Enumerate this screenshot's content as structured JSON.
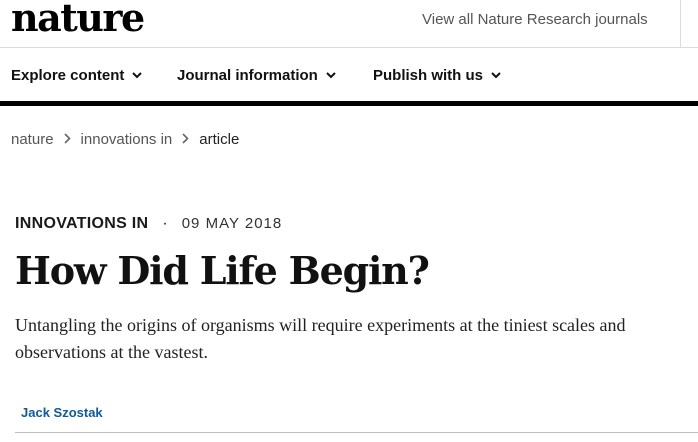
{
  "header": {
    "logo": "nature",
    "journals_link": "View all Nature Research journals"
  },
  "nav": {
    "items": [
      {
        "label": "Explore content",
        "icon": "chevron-down-icon"
      },
      {
        "label": "Journal information",
        "icon": "chevron-down-icon"
      },
      {
        "label": "Publish with us",
        "icon": "chevron-down-icon"
      }
    ]
  },
  "breadcrumb": {
    "items": [
      "nature",
      "innovations in",
      "article"
    ],
    "separator_icon": "chevron-right-icon"
  },
  "article": {
    "type": "INNOVATIONS IN",
    "separator": "·",
    "date": "09 MAY 2018",
    "title": "How Did Life Begin?",
    "standfirst": "Untangling the origins of organisms will require experiments at the tiniest scales and observations at the vastest.",
    "author": "Jack Szostak"
  },
  "colors": {
    "nav_rule": "#000000",
    "author_link": "#0f5a99"
  }
}
